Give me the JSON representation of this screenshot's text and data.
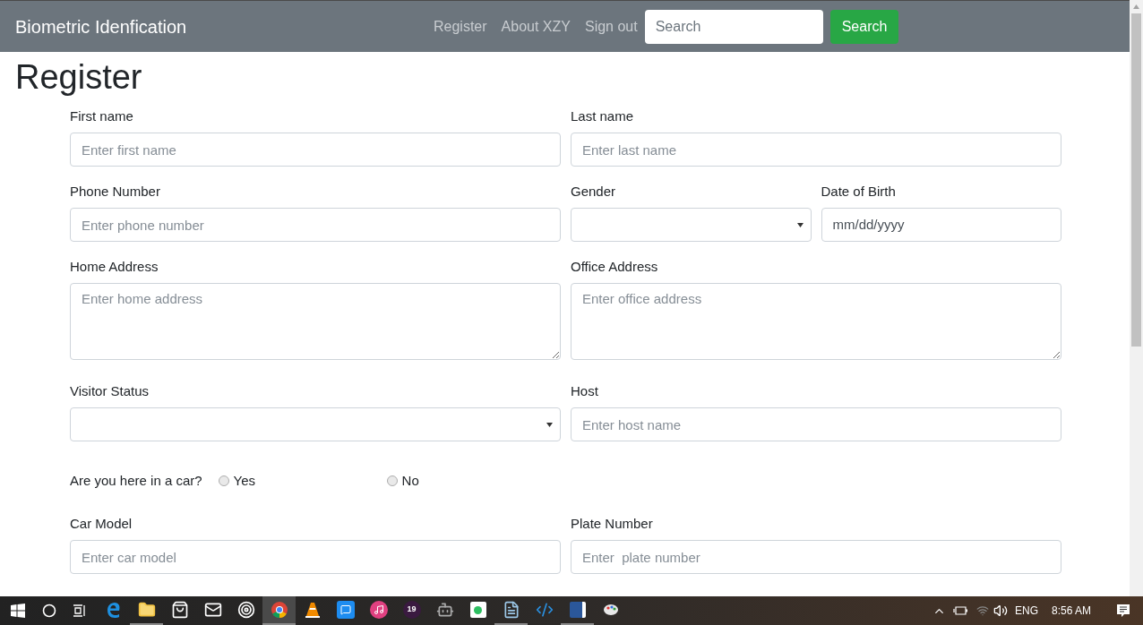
{
  "navbar": {
    "brand": "Biometric Idenfication",
    "links": [
      "Register",
      "About XZY",
      "Sign out"
    ],
    "search": {
      "placeholder": "Search"
    },
    "search_button": "Search"
  },
  "heading": "Register",
  "form": {
    "rows": [
      [
        {
          "kind": "text",
          "label": "First name",
          "placeholder": "Enter first name"
        },
        {
          "kind": "text",
          "label": "Last name",
          "placeholder": "Enter last name"
        }
      ],
      [
        {
          "kind": "text",
          "label": "Phone Number",
          "placeholder": "Enter phone number"
        },
        {
          "kind": "select",
          "label": "Gender"
        },
        {
          "kind": "date",
          "label": "Date of Birth",
          "placeholder": "mm/dd/yyyy"
        }
      ],
      [
        {
          "kind": "textarea",
          "label": "Home Address",
          "placeholder": "Enter home address"
        },
        {
          "kind": "textarea",
          "label": "Office Address",
          "placeholder": "Enter office address"
        }
      ],
      [
        {
          "kind": "select",
          "label": "Visitor Status"
        },
        {
          "kind": "text",
          "label": "Host",
          "placeholder": "Enter host name"
        }
      ],
      [
        {
          "kind": "radio",
          "label": "Are you here in a car?",
          "options": [
            {
              "label": "Yes",
              "selected": false
            },
            {
              "label": "No",
              "selected": false
            }
          ]
        }
      ],
      [
        {
          "kind": "text",
          "label": "Car Model",
          "placeholder": "Enter car model"
        },
        {
          "kind": "text",
          "label": "Plate Number",
          "placeholder": "Enter  plate number"
        }
      ]
    ]
  },
  "taskbar": {
    "apps": [
      {
        "kind": "edge",
        "running": false,
        "selected": false
      },
      {
        "kind": "folder",
        "running": true,
        "selected": false
      },
      {
        "kind": "store",
        "running": false,
        "selected": false
      },
      {
        "kind": "mail",
        "running": false,
        "selected": false
      },
      {
        "kind": "target",
        "running": false,
        "selected": false
      },
      {
        "kind": "chrome",
        "running": true,
        "selected": true
      },
      {
        "kind": "cone",
        "running": false,
        "selected": false
      },
      {
        "kind": "messenger",
        "running": false,
        "selected": false
      },
      {
        "kind": "music",
        "running": false,
        "selected": false
      },
      {
        "kind": "badge",
        "text": "19",
        "running": false,
        "selected": false
      },
      {
        "kind": "robot",
        "running": false,
        "selected": false
      },
      {
        "kind": "evernote",
        "running": false,
        "selected": false
      },
      {
        "kind": "notepad",
        "running": true,
        "selected": false
      },
      {
        "kind": "vscode",
        "running": false,
        "selected": false
      },
      {
        "kind": "word",
        "running": true,
        "selected": false
      },
      {
        "kind": "paint",
        "running": false,
        "selected": false
      }
    ],
    "language": "ENG",
    "time": "8:56 AM"
  }
}
